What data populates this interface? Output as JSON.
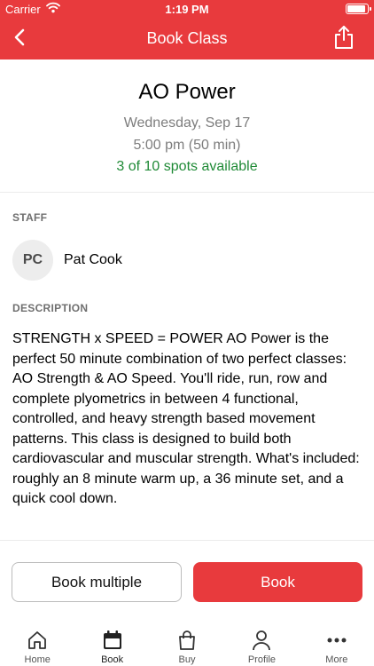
{
  "status_bar": {
    "carrier": "Carrier",
    "time": "1:19 PM"
  },
  "nav": {
    "title": "Book Class",
    "back_icon": "chevron-left-icon",
    "share_icon": "share-icon"
  },
  "class_info": {
    "title": "AO Power",
    "date": "Wednesday, Sep 17",
    "time": "5:00 pm (50 min)",
    "availability": "3 of 10 spots available"
  },
  "staff": {
    "section_label": "STAFF",
    "initials": "PC",
    "name": "Pat Cook"
  },
  "description": {
    "section_label": "DESCRIPTION",
    "text": "STRENGTH x SPEED = POWER   AO Power is the perfect 50 minute combination of two perfect classes: AO Strength & AO Speed. You'll ride, run, row and complete plyometrics in between 4 functional, controlled, and heavy strength based movement patterns. This class is designed to build both cardiovascular and muscular strength. What's included: roughly an 8 minute warm up, a 36 minute set, and a quick cool down."
  },
  "actions": {
    "book_multiple_label": "Book multiple",
    "book_label": "Book"
  },
  "tabs": [
    {
      "label": "Home",
      "icon": "home-icon"
    },
    {
      "label": "Book",
      "icon": "calendar-icon",
      "active": true
    },
    {
      "label": "Buy",
      "icon": "shopping-bag-icon"
    },
    {
      "label": "Profile",
      "icon": "person-icon"
    },
    {
      "label": "More",
      "icon": "more-dots-icon"
    }
  ],
  "colors": {
    "accent": "#e83a3d",
    "availability_green": "#1f8a36",
    "muted_text": "#7d7d7d"
  }
}
